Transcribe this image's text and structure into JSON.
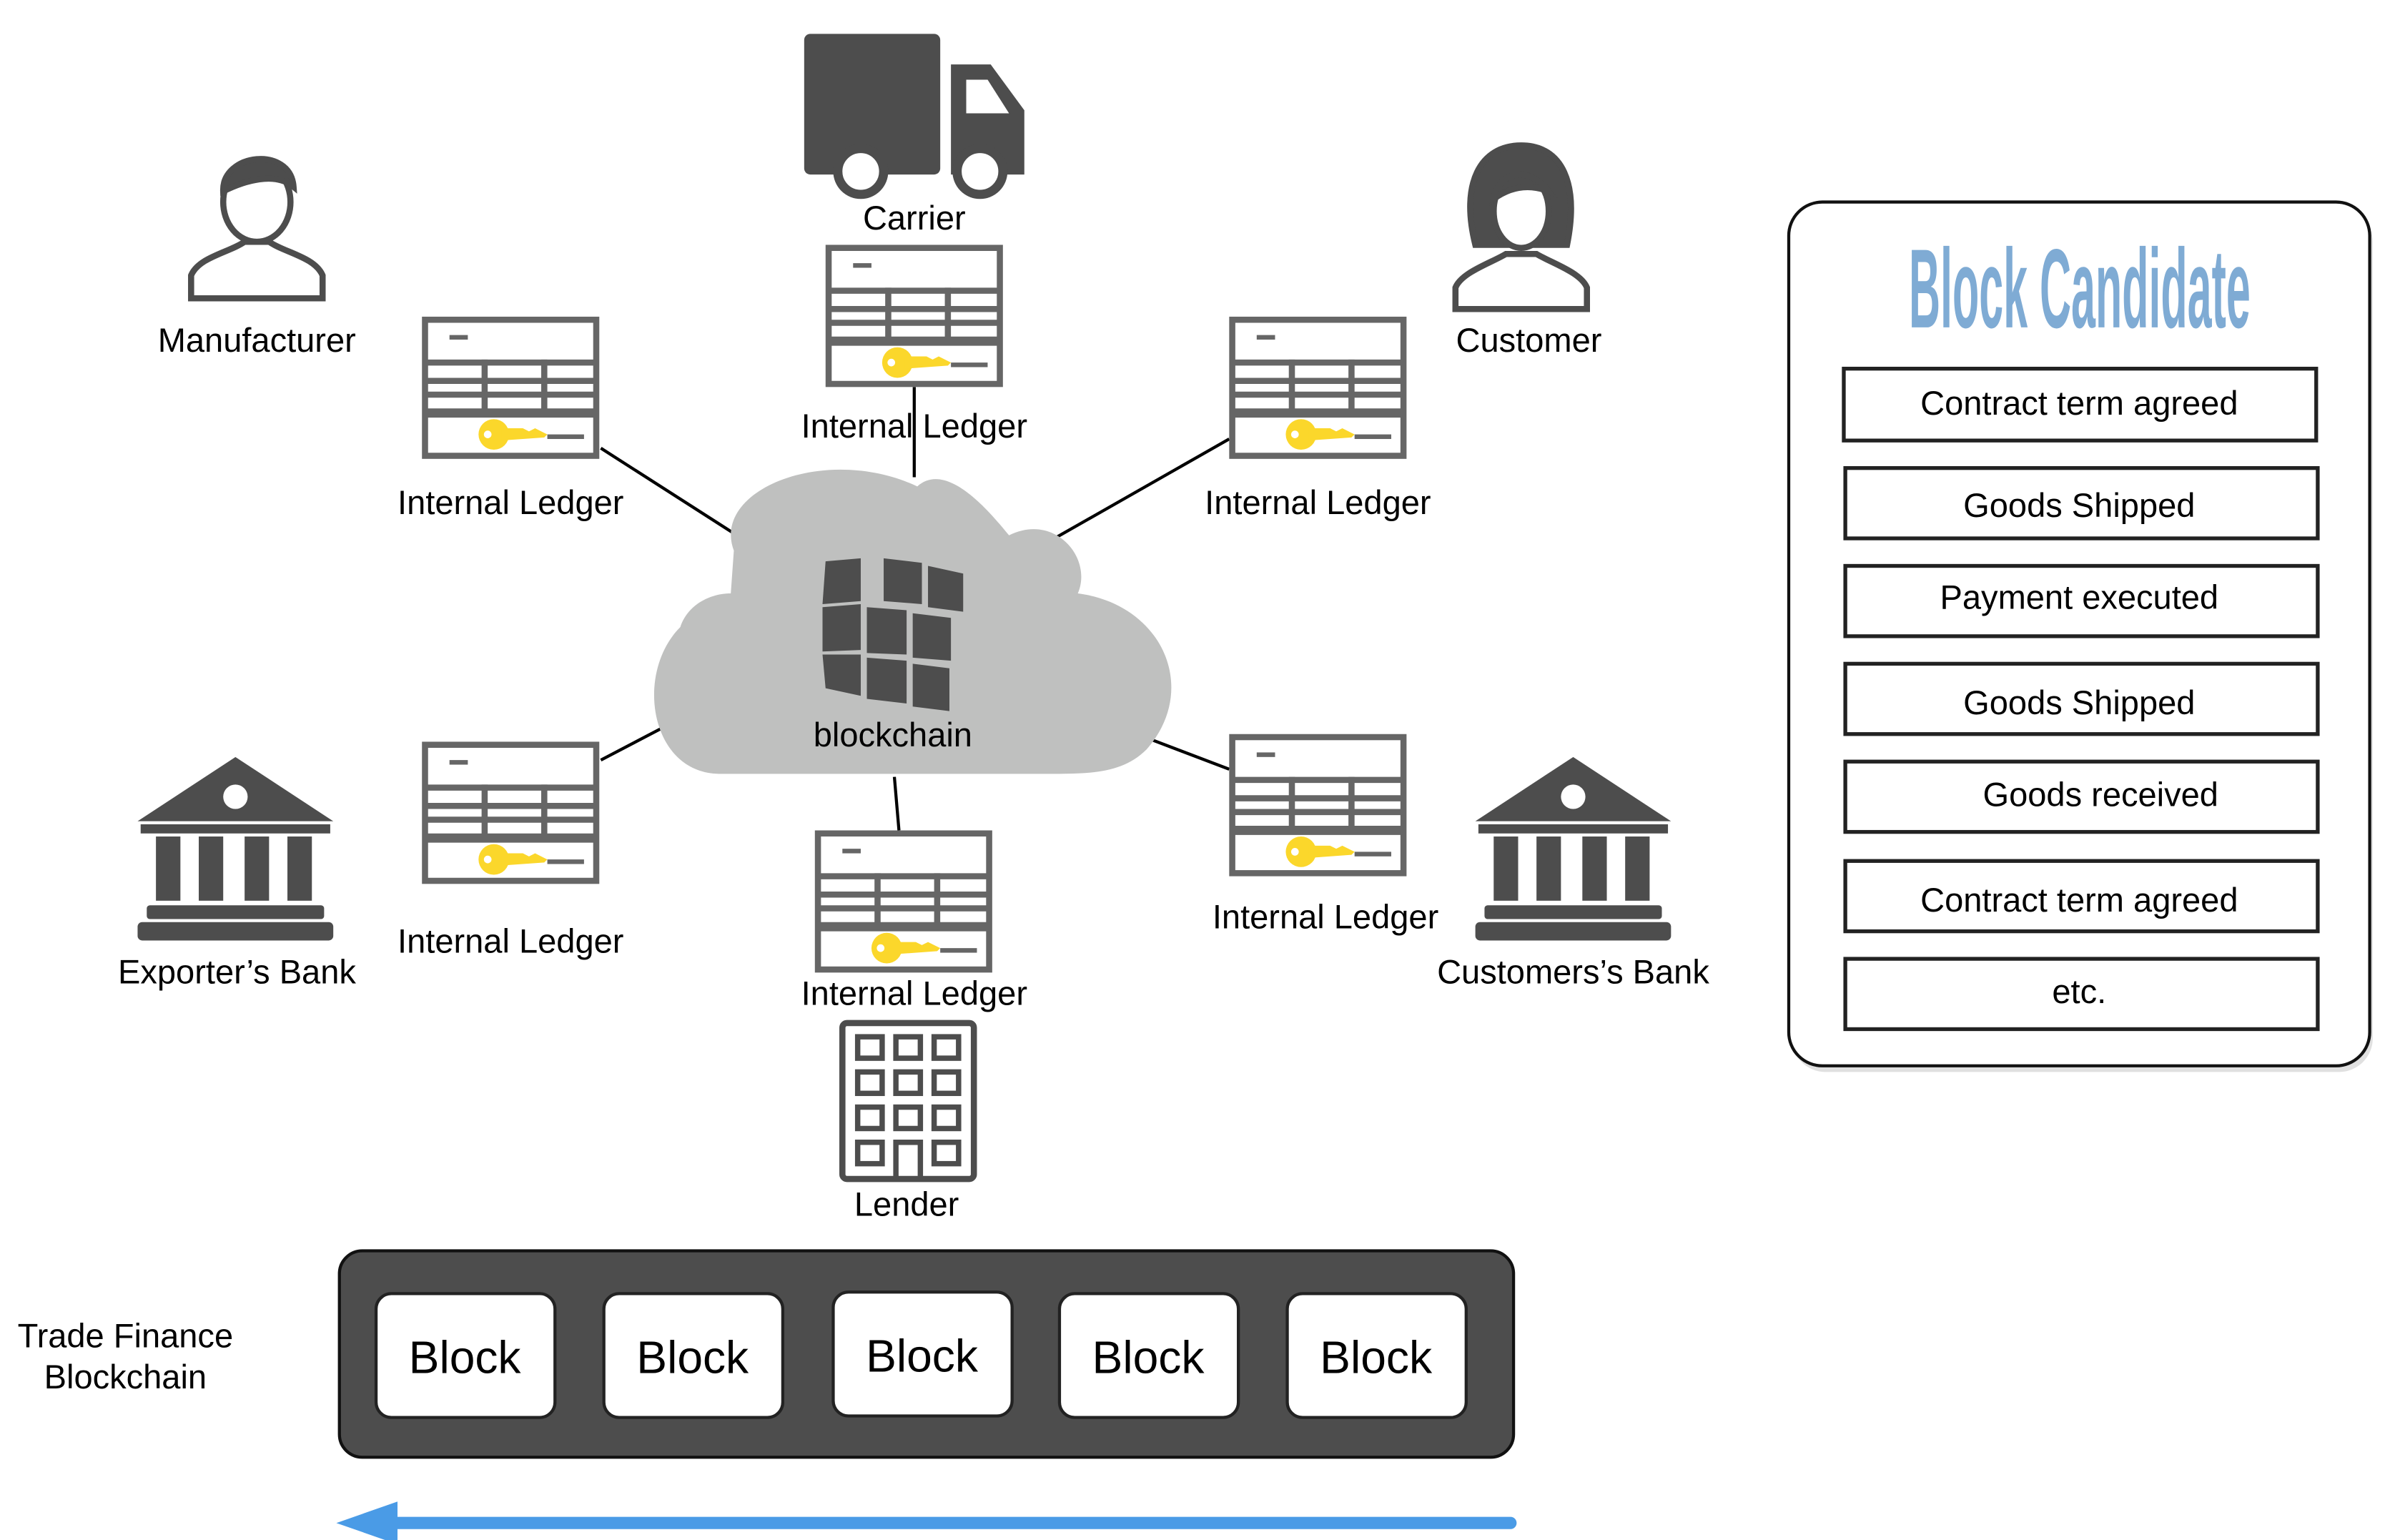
{
  "actors": {
    "manufacturer": "Manufacturer",
    "carrier": "Carrier",
    "customer": "Customer",
    "exporters_bank": "Exporter’s Bank",
    "customers_bank": "Customers’s Bank",
    "lender": "Lender"
  },
  "ledger_label": "Internal Ledger",
  "cloud_label": "blockchain",
  "chain": {
    "label_line1": "Trade Finance",
    "label_line2": "Blockchain",
    "blocks": [
      "Block",
      "Block",
      "Block",
      "Block",
      "Block"
    ]
  },
  "candidate": {
    "title": "Block Candidate",
    "items": [
      "Contract term agreed",
      "Goods Shipped",
      "Payment executed",
      "Goods Shipped",
      "Goods received",
      "Contract term agreed",
      "etc."
    ]
  },
  "colors": {
    "icon": "#4d4d4d",
    "ledger": "#666666",
    "key": "#fbd72b",
    "cloud": "#bfc0bf",
    "arrow": "#4a9be6",
    "title": "#7fabd4"
  }
}
